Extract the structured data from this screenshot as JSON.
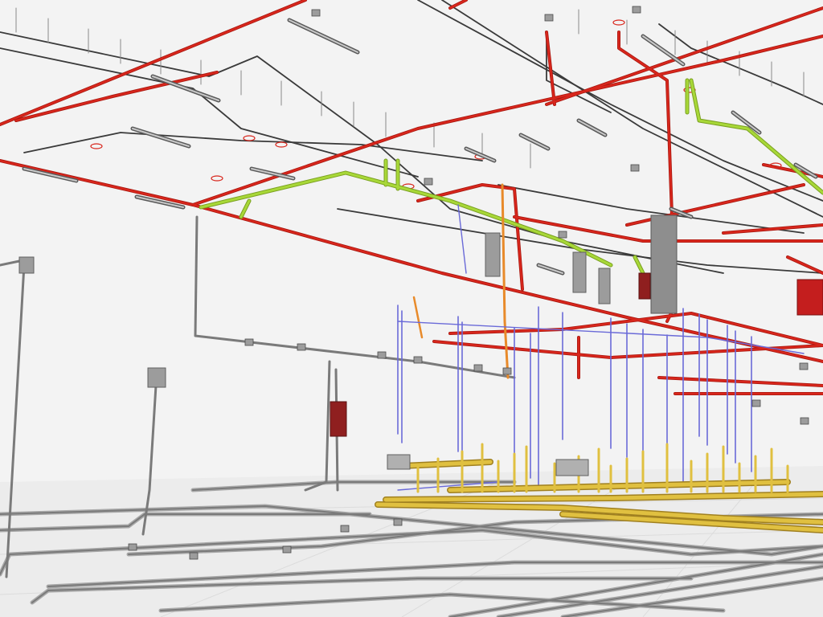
{
  "title": "",
  "colors": {
    "background": "#f3f3f3",
    "floor": "#e6e6e6",
    "conduit": "#7a7a7a",
    "conduit_light": "#a8a8a8",
    "electrical_dark": "#3a3a3a",
    "fire_sprinkler": "#d8261c",
    "fire_sprinkler_dark": "#a81810",
    "domestic_water": "#6a6ad8",
    "waste_vent": "#e0c040",
    "gas": "#a8d838",
    "chilled_water": "#e88a2a",
    "panel": "#8f1f1f",
    "junction_box": "#9c9c9c"
  },
  "legend": []
}
